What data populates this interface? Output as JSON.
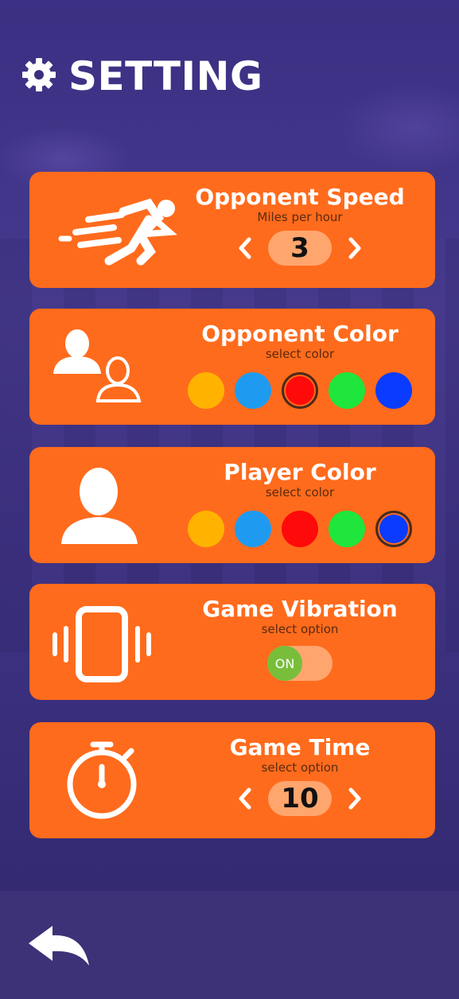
{
  "screen": {
    "title": "SETTING"
  },
  "opponent_speed": {
    "title": "Opponent Speed",
    "subtitle": "Miles per hour",
    "value": "3"
  },
  "opponent_color": {
    "title": "Opponent Color",
    "subtitle": "select color",
    "options": [
      "#ffb300",
      "#1e9bf0",
      "#ff0a0a",
      "#1ee63c",
      "#0a3cff"
    ],
    "selected_index": 2
  },
  "player_color": {
    "title": "Player Color",
    "subtitle": "select color",
    "options": [
      "#ffb300",
      "#1e9bf0",
      "#ff0a0a",
      "#1ee63c",
      "#0a3cff"
    ],
    "selected_index": 4
  },
  "game_vibration": {
    "title": "Game Vibration",
    "subtitle": "select option",
    "toggle_label": "ON"
  },
  "game_time": {
    "title": "Game Time",
    "subtitle": "select option",
    "value": "10"
  },
  "icons": {
    "settings": "gear-icon",
    "speed": "runner-icon",
    "opponent": "two-users-icon",
    "player": "user-icon",
    "vibration": "phone-vibration-icon",
    "time": "stopwatch-icon",
    "back": "back-arrow-icon"
  },
  "colors": {
    "card": "#ff6b1c",
    "pill": "#ffa56e",
    "background": "#3a2f7e",
    "toggle_on": "#78be3a"
  }
}
